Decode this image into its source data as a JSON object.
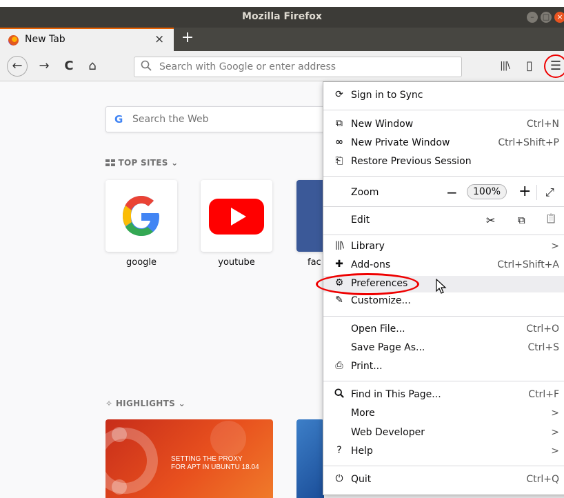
{
  "window": {
    "title": "Mozilla Firefox"
  },
  "tab": {
    "label": "New Tab",
    "close": "×",
    "new_tab": "+"
  },
  "toolbar": {
    "back": "←",
    "forward": "→",
    "reload": "C",
    "home": "⌂",
    "url_placeholder": "Search with Google or enter address",
    "library": "|||\\",
    "sidebar": "▯",
    "menu": "☰"
  },
  "newtab": {
    "web_search_placeholder": "Search the Web",
    "google_logo": "G",
    "top_sites_title": "TOP SITES",
    "top_sites": [
      {
        "label": "google"
      },
      {
        "label": "youtube"
      },
      {
        "label": "fac"
      }
    ],
    "highlights_title": "HIGHLIGHTS",
    "highlight_card_text": [
      "SETTING THE PROXY",
      "FOR APT IN UBUNTU 18.04"
    ]
  },
  "app_menu": {
    "sign_in": "Sign in to Sync",
    "new_window": {
      "label": "New Window",
      "shortcut": "Ctrl+N"
    },
    "new_private": {
      "label": "New Private Window",
      "shortcut": "Ctrl+Shift+P"
    },
    "restore": {
      "label": "Restore Previous Session"
    },
    "zoom": {
      "label": "Zoom",
      "minus": "−",
      "value": "100%",
      "plus": "+",
      "fullscreen": "⤢"
    },
    "edit": {
      "label": "Edit",
      "cut": "✂",
      "copy": "⧉",
      "paste": "📋"
    },
    "library": {
      "label": "Library",
      "arrow": ">"
    },
    "addons": {
      "label": "Add-ons",
      "shortcut": "Ctrl+Shift+A"
    },
    "preferences": {
      "label": "Preferences"
    },
    "customize": {
      "label": "Customize..."
    },
    "open_file": {
      "label": "Open File...",
      "shortcut": "Ctrl+O"
    },
    "save_page": {
      "label": "Save Page As...",
      "shortcut": "Ctrl+S"
    },
    "print": {
      "label": "Print..."
    },
    "find": {
      "label": "Find in This Page...",
      "shortcut": "Ctrl+F"
    },
    "more": {
      "label": "More",
      "arrow": ">"
    },
    "web_dev": {
      "label": "Web Developer",
      "arrow": ">"
    },
    "help": {
      "label": "Help",
      "arrow": ">"
    },
    "quit": {
      "label": "Quit",
      "shortcut": "Ctrl+Q"
    }
  },
  "colors": {
    "titlebar": "#3c3b37",
    "tab_accent": "#e66000",
    "annotation_red": "#ee0000"
  }
}
